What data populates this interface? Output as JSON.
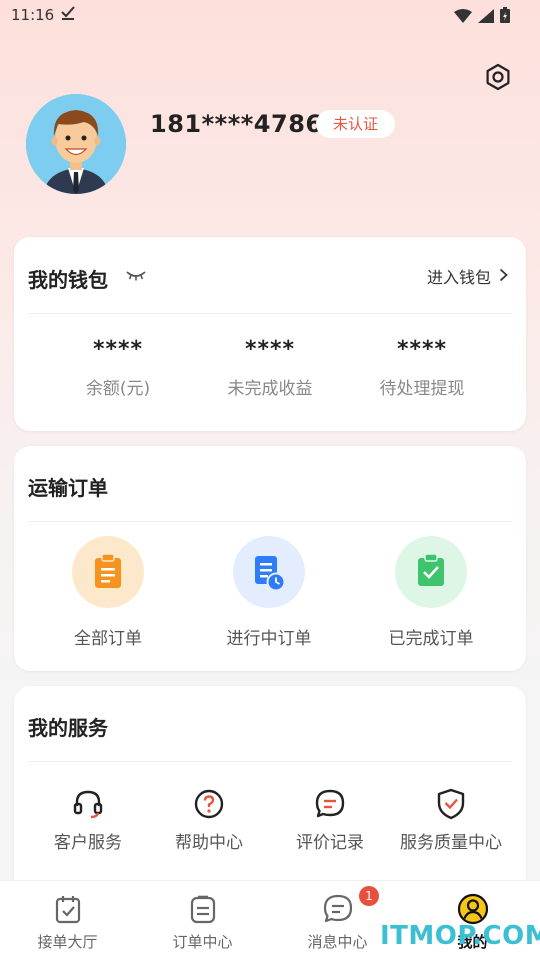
{
  "status_bar": {
    "time": "11:16"
  },
  "profile": {
    "phone": "181****4786",
    "cert_status": "未认证"
  },
  "wallet": {
    "title": "我的钱包",
    "enter_label": "进入钱包",
    "stats": [
      {
        "value": "****",
        "label": "余额(元)"
      },
      {
        "value": "****",
        "label": "未完成收益"
      },
      {
        "value": "****",
        "label": "待处理提现"
      }
    ]
  },
  "orders": {
    "title": "运输订单",
    "items": [
      {
        "label": "全部订单",
        "icon": "clipboard-icon",
        "bg": "#fde8cc",
        "fg": "#f5931e"
      },
      {
        "label": "进行中订单",
        "icon": "document-clock-icon",
        "bg": "#e3edfd",
        "fg": "#2f7cf6"
      },
      {
        "label": "已完成订单",
        "icon": "clipboard-check-icon",
        "bg": "#def6e6",
        "fg": "#3ec46d"
      }
    ]
  },
  "services": {
    "title": "我的服务",
    "items": [
      {
        "label": "客户服务",
        "icon": "headset-icon"
      },
      {
        "label": "帮助中心",
        "icon": "question-circle-icon"
      },
      {
        "label": "评价记录",
        "icon": "chat-bubble-icon"
      },
      {
        "label": "服务质量中心",
        "icon": "shield-check-icon"
      }
    ]
  },
  "tabbar": {
    "tabs": [
      {
        "label": "接单大厅",
        "icon": "clipboard-check-tab-icon"
      },
      {
        "label": "订单中心",
        "icon": "list-tab-icon"
      },
      {
        "label": "消息中心",
        "icon": "message-tab-icon",
        "badge": "1"
      },
      {
        "label": "我的",
        "icon": "user-tab-icon",
        "active": true
      }
    ]
  },
  "watermark": "ITMOP.COM",
  "colors": {
    "accent_red": "#e8553f",
    "badge_red": "#e94f3d",
    "watermark": "#3bbfd2"
  }
}
